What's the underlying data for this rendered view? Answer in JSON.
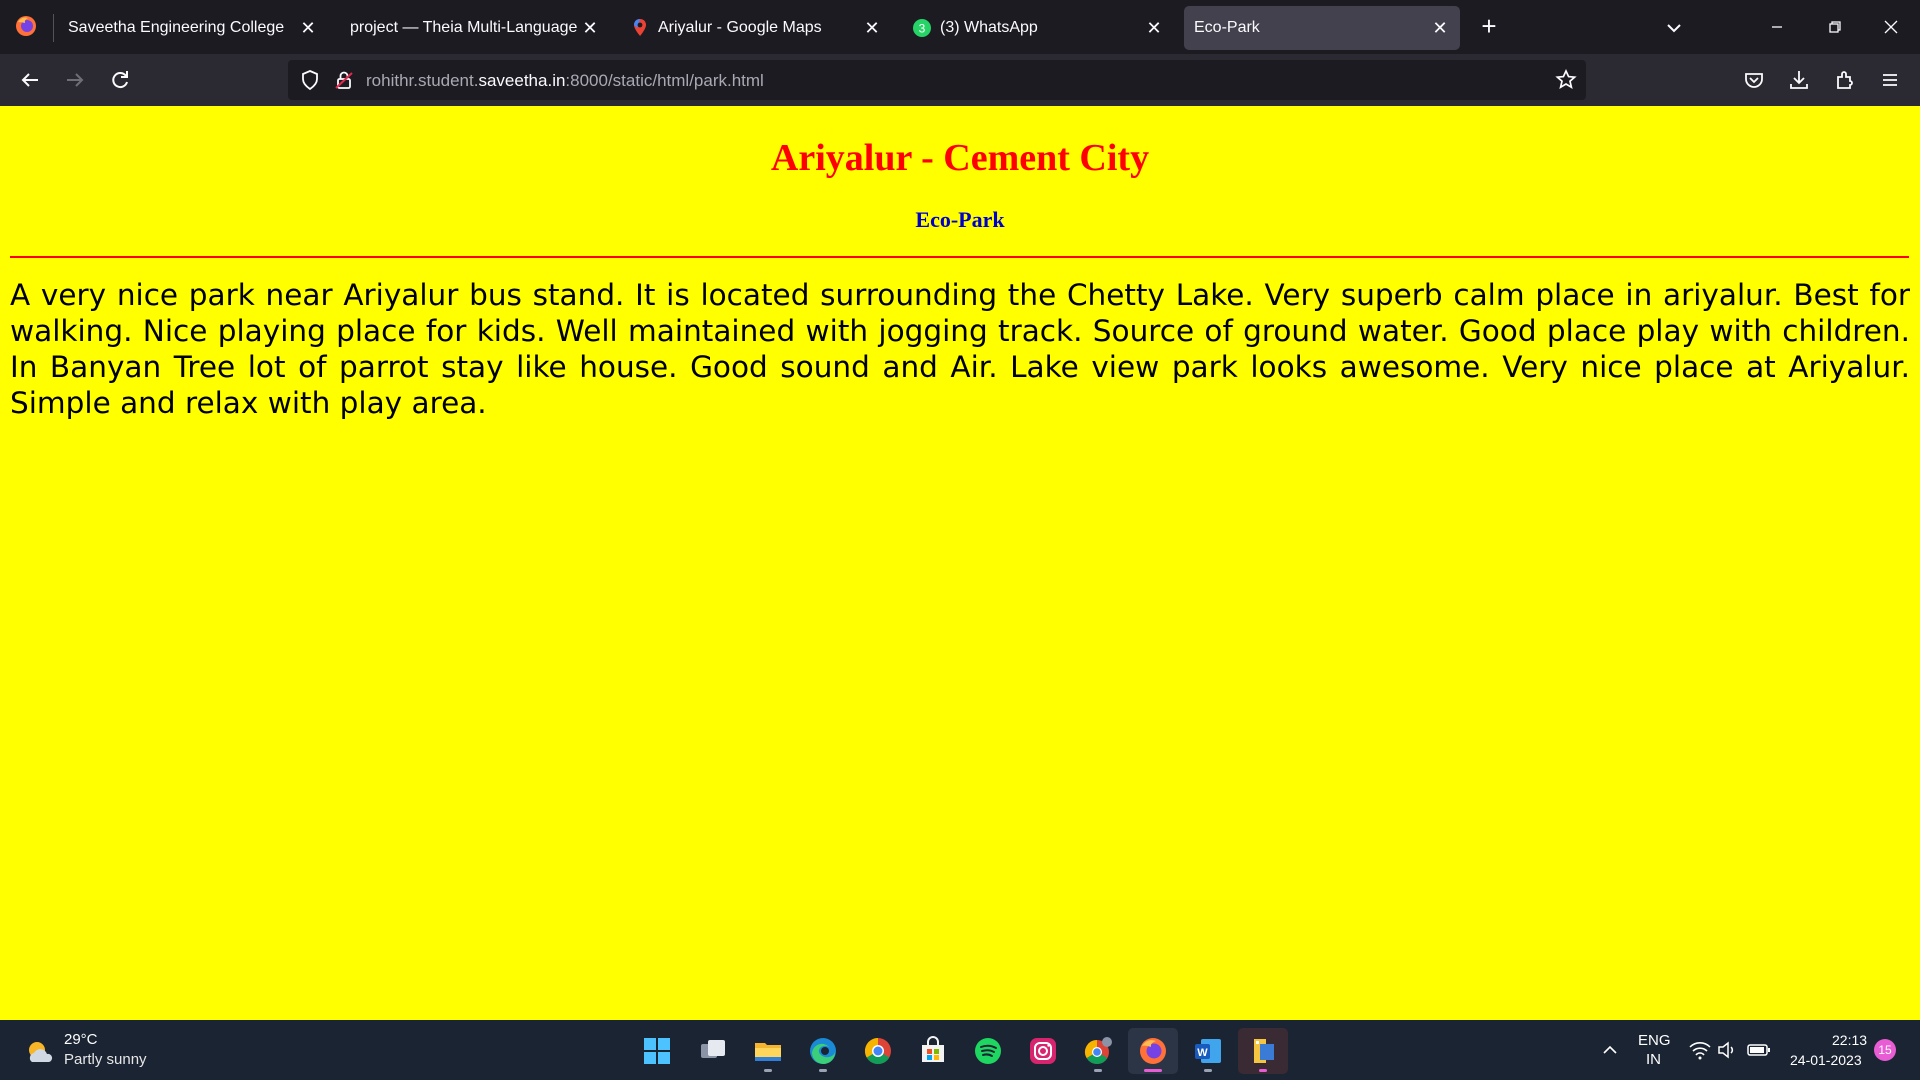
{
  "browser": {
    "tabs": [
      {
        "title": "Saveetha Engineering College",
        "active": false
      },
      {
        "title": "project — Theia Multi-Language Ex",
        "active": false
      },
      {
        "title": "Ariyalur - Google Maps",
        "active": false
      },
      {
        "title": "(3) WhatsApp",
        "active": false,
        "badge": "3"
      },
      {
        "title": "Eco-Park",
        "active": true
      }
    ],
    "url": {
      "prefix": "rohithr.student.",
      "domain": "saveetha.in",
      "suffix": ":8000/static/html/park.html"
    }
  },
  "page": {
    "title": "Ariyalur - Cement City",
    "subtitle": "Eco-Park",
    "body": "A very nice park near Ariyalur bus stand. It is located surrounding the Chetty Lake. Very superb calm place in ariyalur. Best for walking. Nice playing place for kids. Well maintained with jogging track. Source of ground water. Good place play with children. In Banyan Tree lot of parrot stay like house. Good sound and Air. Lake view park looks awesome. Very nice place at Ariyalur. Simple and relax with play area.",
    "colors": {
      "background": "#ffff00",
      "title": "#ff0000",
      "subtitle": "#0000cc",
      "rule": "#ff0000"
    }
  },
  "taskbar": {
    "weather": {
      "temp": "29°C",
      "desc": "Partly sunny"
    },
    "apps": [
      "start",
      "task-view",
      "file-explorer",
      "edge",
      "chrome",
      "microsoft-store",
      "spotify",
      "instagram",
      "chrome-profile",
      "firefox",
      "word",
      "winrar"
    ],
    "tray": {
      "lang_top": "ENG",
      "lang_bottom": "IN",
      "time": "22:13",
      "date": "24-01-2023",
      "notifications": "15"
    }
  }
}
